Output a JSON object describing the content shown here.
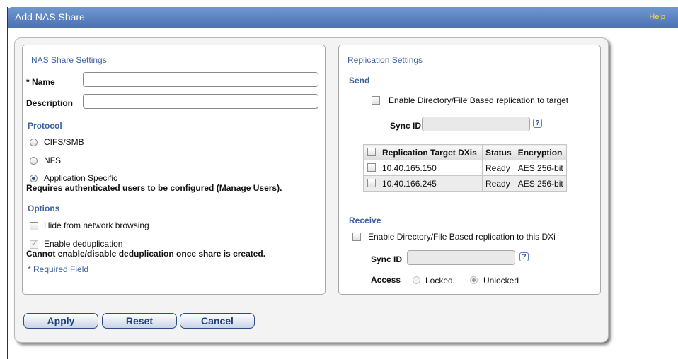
{
  "window": {
    "title": "Add NAS Share",
    "help": "Help"
  },
  "nas": {
    "title": "NAS Share Settings",
    "name_label": "* Name",
    "name_value": "",
    "description_label": "Description",
    "description_value": "",
    "protocol_heading": "Protocol",
    "protocols": [
      "CIFS/SMB",
      "NFS",
      "Application Specific"
    ],
    "selected_protocol": "Application Specific",
    "app_note": "Requires authenticated users to be configured (Manage Users).",
    "options_heading": "Options",
    "hide_label": "Hide from network browsing",
    "dedup_label": "Enable deduplication",
    "dedup_note": "Cannot enable/disable deduplication once share is created.",
    "required_note": "* Required Field"
  },
  "replication": {
    "title": "Replication Settings",
    "send_heading": "Send",
    "send_enable_label": "Enable Directory/File Based replication to target",
    "send_sync_label": "Sync ID",
    "sync_help": "?",
    "table": {
      "headers": [
        "Replication Target DXis",
        "Status",
        "Encryption"
      ],
      "rows": [
        [
          "10.40.165.150",
          "Ready",
          "AES 256-bit"
        ],
        [
          "10.40.166.245",
          "Ready",
          "AES 256-bit"
        ]
      ]
    },
    "receive_heading": "Receive",
    "receive_enable_label": "Enable Directory/File Based replication to this DXi",
    "receive_sync_label": "Sync ID",
    "access_label": "Access",
    "access_options": [
      "Locked",
      "Unlocked"
    ],
    "access_selected": "Unlocked"
  },
  "buttons": {
    "apply": "Apply",
    "reset": "Reset",
    "cancel": "Cancel"
  }
}
